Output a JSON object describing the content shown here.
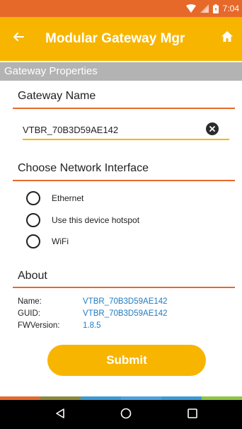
{
  "status_bar": {
    "time": "7:04",
    "icons": [
      "wifi-icon",
      "signal-icon",
      "battery-icon"
    ]
  },
  "app_bar": {
    "title": "Modular Gateway Mgr",
    "back_icon": "arrow-left-icon",
    "home_icon": "home-icon"
  },
  "section_header": "Gateway Properties",
  "gateway_name": {
    "title": "Gateway Name",
    "value": "VTBR_70B3D59AE142",
    "clear_icon": "clear-icon"
  },
  "network_interface": {
    "title": "Choose Network Interface",
    "options": [
      {
        "label": "Ethernet",
        "selected": false
      },
      {
        "label": "Use this device hotspot",
        "selected": false
      },
      {
        "label": "WiFi",
        "selected": false
      }
    ]
  },
  "about": {
    "title": "About",
    "rows": [
      {
        "key": "Name:",
        "value": "VTBR_70B3D59AE142"
      },
      {
        "key": "GUID:",
        "value": "VTBR_70B3D59AE142"
      },
      {
        "key": "FWVersion:",
        "value": "1.8.5"
      }
    ]
  },
  "submit_label": "Submit",
  "colors": {
    "status_bar": "#e6692a",
    "app_bar": "#f7b500",
    "section_header": "#b3b3b3",
    "divider": "#e6692a",
    "link_value": "#1f7ac2",
    "accent_strip": [
      "#e6692a",
      "#8a8a3a",
      "#3a9bd5",
      "#4aa3df",
      "#3a9bd5",
      "#8cc63f"
    ]
  },
  "nav_bar": {
    "icons": [
      "back-triangle-icon",
      "home-circle-icon",
      "recents-square-icon"
    ]
  }
}
